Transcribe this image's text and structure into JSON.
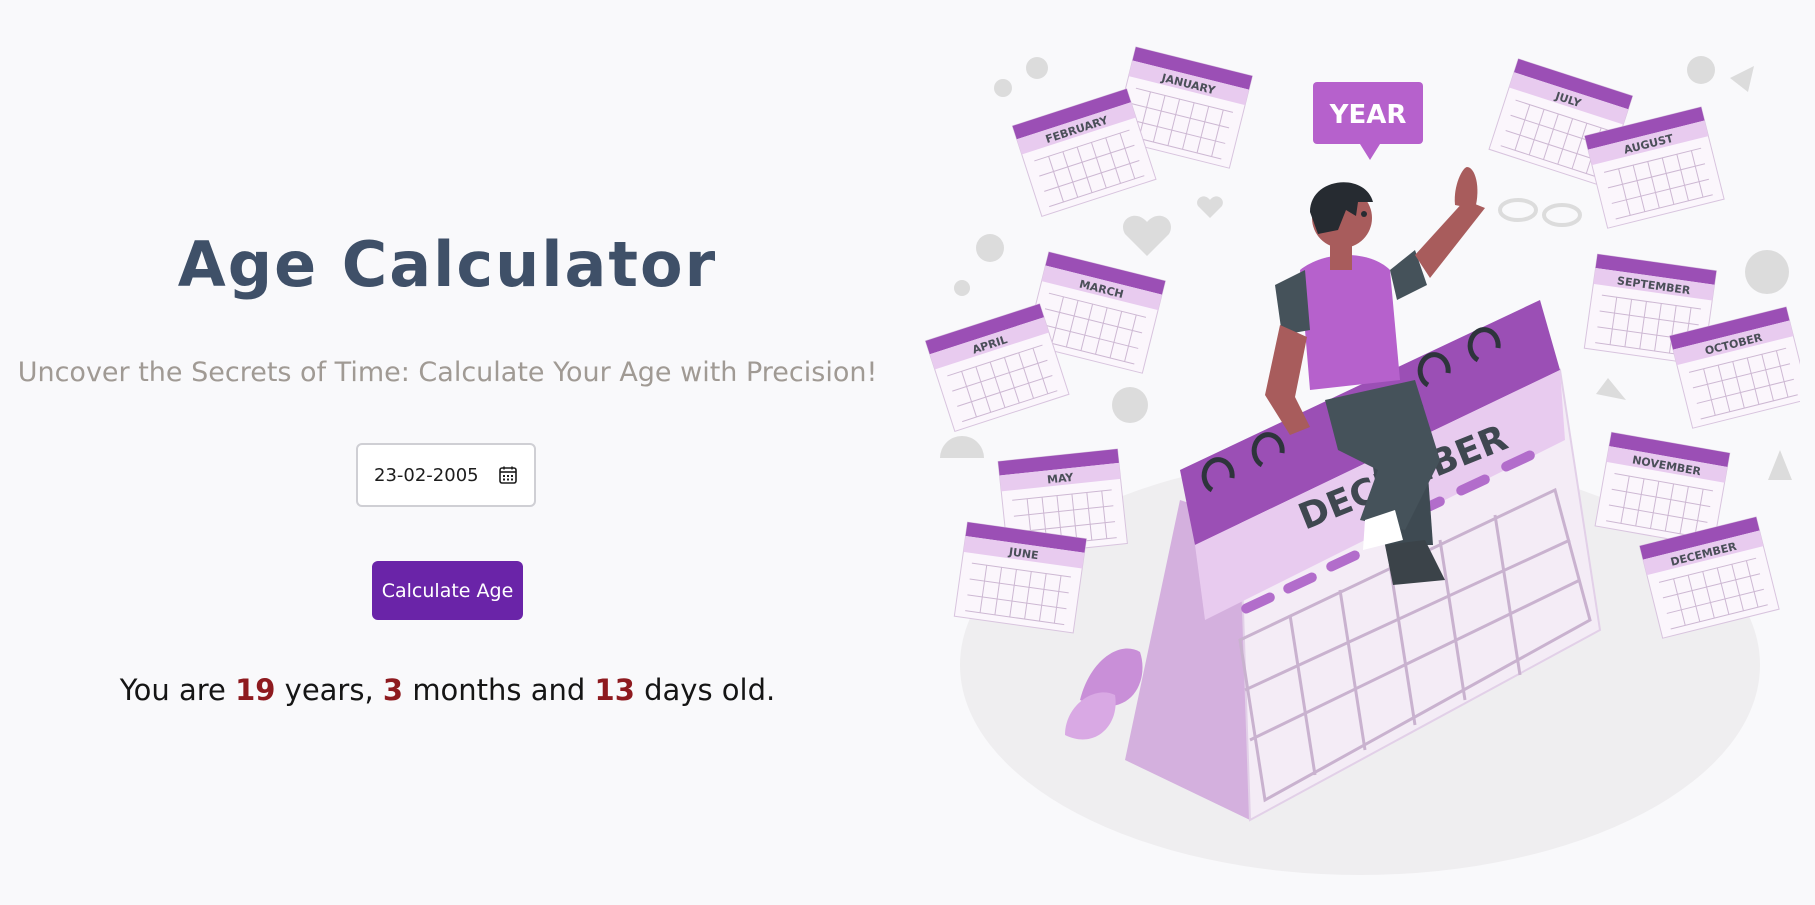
{
  "header": {
    "title": "Age Calculator",
    "subtitle": "Uncover the Secrets of Time: Calculate Your Age with Precision!"
  },
  "form": {
    "date_value": "23-02-2005",
    "calendar_icon": "calendar-icon",
    "submit_label": "Calculate Age"
  },
  "result": {
    "prefix": "You are",
    "years": "19",
    "years_word": "years,",
    "months": "3",
    "months_word": "months and",
    "days": "13",
    "days_word": "days old."
  },
  "illustration": {
    "badge": "YEAR",
    "big_calendar_month": "DECEMBER",
    "months": [
      "JANUARY",
      "FEBRUARY",
      "MARCH",
      "APRIL",
      "MAY",
      "JUNE",
      "JULY",
      "AUGUST",
      "SEPTEMBER",
      "OCTOBER",
      "NOVEMBER",
      "DECEMBER"
    ]
  },
  "colors": {
    "title": "#3f5068",
    "subtitle": "#a09a94",
    "button": "#6a24a8",
    "result_number": "#8e1a1f",
    "illustration_accent": "#9b4fb5"
  }
}
